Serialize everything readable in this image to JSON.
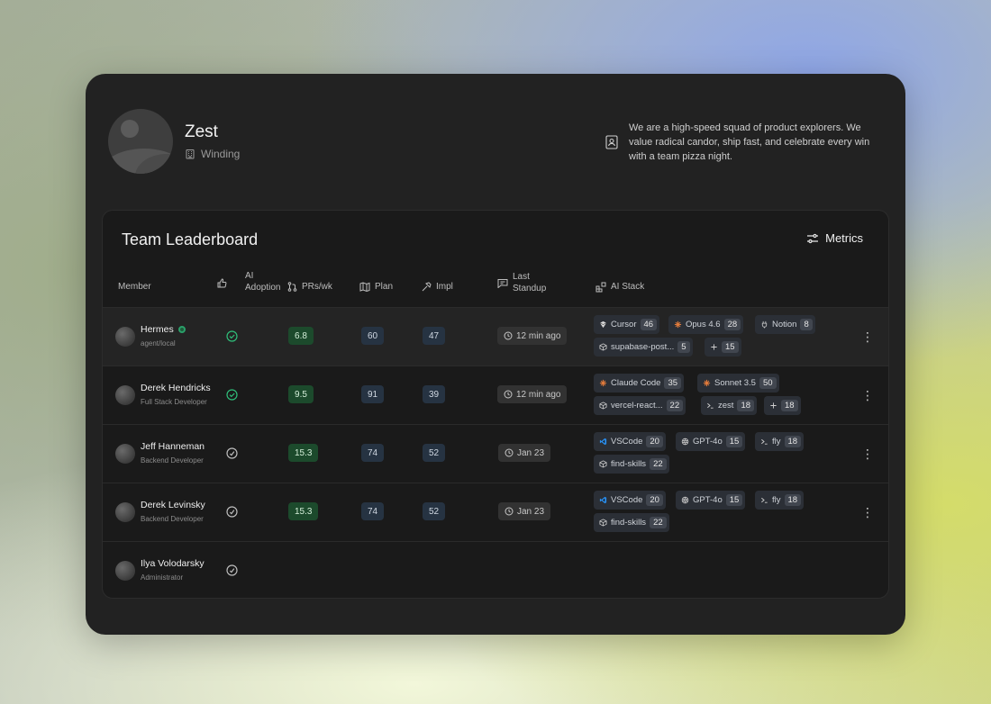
{
  "team": {
    "name": "Zest",
    "location": "Winding",
    "description": "We are a high-speed squad of product explorers. We value radical candor, ship fast, and celebrate every win with a team pizza night."
  },
  "board": {
    "title": "Team Leaderboard",
    "metrics_label": "Metrics",
    "columns": {
      "member": "Member",
      "ai_adoption_1": "AI",
      "ai_adoption_2": "Adoption",
      "prs": "PRs/wk",
      "plan": "Plan",
      "impl": "Impl",
      "standup_1": "Last",
      "standup_2": "Standup",
      "stack": "AI Stack"
    },
    "rows": [
      {
        "name": "Hermes",
        "role": "agent/local",
        "online": true,
        "adopted": true,
        "prs": "6.8",
        "plan": "60",
        "impl": "47",
        "standup": "12 min ago",
        "stack": [
          {
            "icon": "cursor-icon",
            "label": "Cursor",
            "count": "46"
          },
          {
            "icon": "claude-icon",
            "label": "Opus 4.6",
            "count": "28"
          },
          {
            "icon": "notion-icon",
            "label": "Notion",
            "count": "8"
          },
          {
            "icon": "package-icon",
            "label": "supabase-post...",
            "count": "5"
          },
          {
            "icon": "plus-icon",
            "label": "+",
            "count": "15"
          }
        ]
      },
      {
        "name": "Derek Hendricks",
        "role": "Full Stack Developer",
        "online": false,
        "adopted": true,
        "prs": "9.5",
        "plan": "91",
        "impl": "39",
        "standup": "12 min ago",
        "stack": [
          {
            "icon": "claude-icon",
            "label": "Claude Code",
            "count": "35"
          },
          {
            "icon": "claude-icon",
            "label": "Sonnet 3.5",
            "count": "50"
          },
          {
            "icon": "package-icon",
            "label": "vercel-react...",
            "count": "22"
          },
          {
            "icon": "terminal-icon",
            "label": "zest",
            "count": "18"
          },
          {
            "icon": "plus-icon",
            "label": "+",
            "count": "18"
          }
        ]
      },
      {
        "name": "Jeff Hanneman",
        "role": "Backend Developer",
        "online": false,
        "adopted": false,
        "prs": "15.3",
        "plan": "74",
        "impl": "52",
        "standup": "Jan 23",
        "stack": [
          {
            "icon": "vscode-icon",
            "label": "VSCode",
            "count": "20"
          },
          {
            "icon": "openai-icon",
            "label": "GPT-4o",
            "count": "15"
          },
          {
            "icon": "terminal-icon",
            "label": "fly",
            "count": "18"
          },
          {
            "icon": "package-icon",
            "label": "find-skills",
            "count": "22"
          }
        ]
      },
      {
        "name": "Derek Levinsky",
        "role": "Backend Developer",
        "online": false,
        "adopted": false,
        "prs": "15.3",
        "plan": "74",
        "impl": "52",
        "standup": "Jan 23",
        "stack": [
          {
            "icon": "vscode-icon",
            "label": "VSCode",
            "count": "20"
          },
          {
            "icon": "openai-icon",
            "label": "GPT-4o",
            "count": "15"
          },
          {
            "icon": "terminal-icon",
            "label": "fly",
            "count": "18"
          },
          {
            "icon": "package-icon",
            "label": "find-skills",
            "count": "22"
          }
        ]
      },
      {
        "name": "Ilya Volodarsky",
        "role": "Administrator",
        "online": false,
        "adopted": false,
        "prs": "",
        "plan": "",
        "impl": "",
        "standup": "",
        "stack": []
      }
    ]
  },
  "colors": {
    "card_bg": "#222222",
    "board_bg": "#1a1a1a",
    "green_pill": "#1c4a2c",
    "blue_pill": "#263342",
    "adopted_check": "#2fbf7a",
    "claude_orange": "#e07a3b",
    "vscode_blue": "#2a8ff0"
  }
}
